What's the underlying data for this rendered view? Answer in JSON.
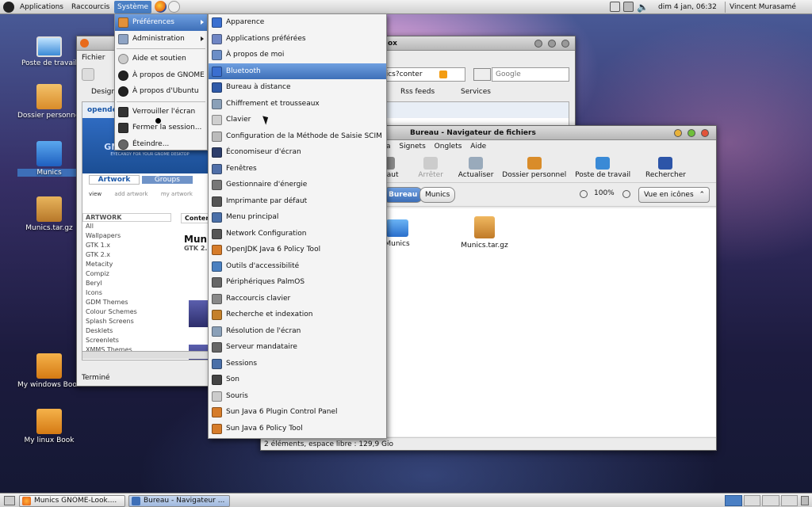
{
  "top_panel": {
    "menus": [
      "Applications",
      "Raccourcis",
      "Système"
    ],
    "date": "dim  4 jan, 06:32",
    "user": "Vincent Murasamé"
  },
  "desktop_icons": [
    {
      "label": "Poste de travail",
      "icon": "computer-icon"
    },
    {
      "label": "Dossier personnel",
      "icon": "home-folder-icon"
    },
    {
      "label": "Munics",
      "icon": "folder-icon"
    },
    {
      "label": "Munics.tar.gz",
      "icon": "archive-icon"
    },
    {
      "label": "My windows Book",
      "icon": "usb-drive-icon"
    },
    {
      "label": "My linux Book",
      "icon": "usb-drive-icon"
    }
  ],
  "system_menu": [
    {
      "label": "Préférences",
      "icon": "preferences-icon",
      "submenu": true
    },
    {
      "label": "Administration",
      "icon": "administration-icon",
      "submenu": true
    },
    {
      "label": "Aide et soutien",
      "icon": "help-icon"
    },
    {
      "label": "À propos de GNOME",
      "icon": "gnome-icon"
    },
    {
      "label": "À propos d'Ubuntu",
      "icon": "ubuntu-icon"
    },
    {
      "label": "Verrouiller l'écran",
      "icon": "lock-icon"
    },
    {
      "label": "Fermer la session...",
      "icon": "logout-icon"
    },
    {
      "label": "Éteindre...",
      "icon": "power-icon"
    }
  ],
  "preferences_menu": [
    "Apparence",
    "Applications préférées",
    "À propos de moi",
    "Bluetooth",
    "Bureau à distance",
    "Chiffrement et trousseaux",
    "Clavier",
    "Configuration de la Méthode de Saisie SCIM",
    "Économiseur d'écran",
    "Fenêtres",
    "Gestionnaire d'énergie",
    "Imprimante par défaut",
    "Menu principal",
    "Network Configuration",
    "OpenJDK Java 6 Policy Tool",
    "Outils d'accessibilité",
    "Périphériques PalmOS",
    "Raccourcis clavier",
    "Recherche et indexation",
    "Résolution de l'écran",
    "Serveur mandataire",
    "Sessions",
    "Son",
    "Souris",
    "Sun Java 6 Plugin Control Panel",
    "Sun Java 6 Policy Tool"
  ],
  "highlighted_pref": "Bluetooth",
  "firefox": {
    "title_fragment": "ox",
    "menu_first": "Fichier",
    "url_fragment": "nics?conter",
    "search_placeholder": "Google",
    "bookmarks": [
      "Design",
      "Rss feeds",
      "Services"
    ],
    "site_logo": "opendesktop",
    "tabs": [
      "Artwork",
      "Groups"
    ],
    "subtabs": [
      "view",
      "add artwork",
      "my artwork"
    ],
    "artwork_heading": "ARTWORK",
    "artwork_list": [
      "All",
      "Wallpapers",
      "GTK 1.x",
      "GTK 2.x",
      "Metacity",
      "Compiz",
      "Beryl",
      "Icons",
      "GDM Themes",
      "Colour Schemes",
      "Splash Screens",
      "Desklets",
      "Screenlets",
      "XMMS Themes"
    ],
    "content_title": "Munics",
    "content_sub": "GTK 2.",
    "content_tab": "Conter",
    "banner_text": "GNOME-LOOK.ORG",
    "banner_tag": "EYECANDY FOR YOUR GNOME DESKTOP",
    "status": "Terminé"
  },
  "nautilus": {
    "title": "Bureau - Navigateur de fichiers",
    "menu": [
      "a",
      "Signets",
      "Onglets",
      "Aide"
    ],
    "toolbar": [
      "Haut",
      "Arrêter",
      "Actualiser",
      "Dossier personnel",
      "Poste de travail",
      "Rechercher"
    ],
    "path": [
      "Bureau",
      "Munics"
    ],
    "zoom": "100%",
    "view_mode": "Vue en icônes",
    "files": [
      {
        "name": "Munics",
        "type": "folder"
      },
      {
        "name": "Munics.tar.gz",
        "type": "archive"
      }
    ],
    "status": "2 éléments, espace libre : 129,9 Gio"
  },
  "taskbar": [
    {
      "label": "Munics GNOME-Look....",
      "icon": "firefox-icon"
    },
    {
      "label": "Bureau - Navigateur ...",
      "icon": "file-manager-icon"
    }
  ]
}
